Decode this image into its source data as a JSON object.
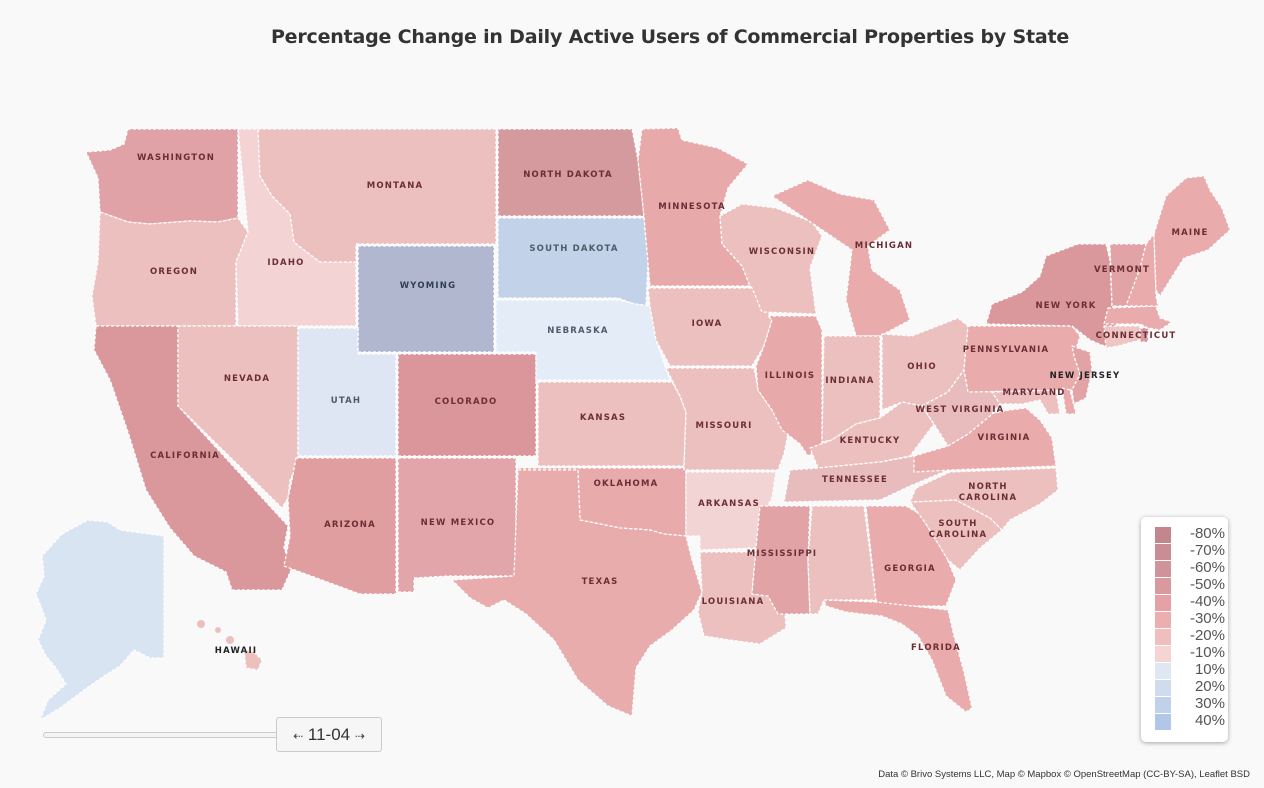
{
  "title": "Percentage Change in Daily Active Users of Commercial Properties by State",
  "legend": {
    "items": [
      {
        "label": "-80%",
        "color": "#c4868d"
      },
      {
        "label": "-70%",
        "color": "#ca8d93"
      },
      {
        "label": "-60%",
        "color": "#d0939a"
      },
      {
        "label": "-50%",
        "color": "#d9999e"
      },
      {
        "label": "-40%",
        "color": "#e5a1a3"
      },
      {
        "label": "-30%",
        "color": "#ecaeae"
      },
      {
        "label": "-20%",
        "color": "#f0bfbd"
      },
      {
        "label": "-10%",
        "color": "#f5d5d4"
      },
      {
        "label": "10%",
        "color": "#dfe7f3"
      },
      {
        "label": "20%",
        "color": "#cfdcee"
      },
      {
        "label": "30%",
        "color": "#c0d1ea"
      },
      {
        "label": "40%",
        "color": "#b2c7e7"
      }
    ]
  },
  "timeline": {
    "date": "11-04",
    "prev_arrow": "⇠",
    "next_arrow": "⇢"
  },
  "attribution": "Data © Brivo Systems LLC, Map © Mapbox © OpenStreetMap (CC-BY-SA), Leaflet BSD",
  "states": [
    {
      "name": "Washington",
      "label": "WASHINGTON",
      "color": "#e0a2a6"
    },
    {
      "name": "Oregon",
      "label": "OREGON",
      "color": "#ecc0bf"
    },
    {
      "name": "California",
      "label": "CALIFORNIA",
      "color": "#da989d"
    },
    {
      "name": "Idaho",
      "label": "IDAHO",
      "color": "#f3d3d3"
    },
    {
      "name": "Nevada",
      "label": "NEVADA",
      "color": "#ecc0bf"
    },
    {
      "name": "Montana",
      "label": "MONTANA",
      "color": "#ecc0bf"
    },
    {
      "name": "Wyoming",
      "label": "WYOMING",
      "color": "#b2b7d0"
    },
    {
      "name": "Utah",
      "label": "UTAH",
      "color": "#dfe6f3"
    },
    {
      "name": "Colorado",
      "label": "COLORADO",
      "color": "#da969b"
    },
    {
      "name": "Arizona",
      "label": "ARIZONA",
      "color": "#e09ea1"
    },
    {
      "name": "New Mexico",
      "label": "NEW MEXICO",
      "color": "#e2a6aa"
    },
    {
      "name": "North Dakota",
      "label": "NORTH DAKOTA",
      "color": "#d49a9d"
    },
    {
      "name": "South Dakota",
      "label": "SOUTH DAKOTA",
      "color": "#c2d2e8"
    },
    {
      "name": "Nebraska",
      "label": "NEBRASKA",
      "color": "#e4ecf7"
    },
    {
      "name": "Kansas",
      "label": "KANSAS",
      "color": "#ecc0bf"
    },
    {
      "name": "Oklahoma",
      "label": "OKLAHOMA",
      "color": "#e8aaab"
    },
    {
      "name": "Texas",
      "label": "TEXAS",
      "color": "#e9acad"
    },
    {
      "name": "Minnesota",
      "label": "MINNESOTA",
      "color": "#e8a9aa"
    },
    {
      "name": "Iowa",
      "label": "IOWA",
      "color": "#ecc0bf"
    },
    {
      "name": "Missouri",
      "label": "MISSOURI",
      "color": "#ecc0bf"
    },
    {
      "name": "Arkansas",
      "label": "ARKANSAS",
      "color": "#f3d4d4"
    },
    {
      "name": "Louisiana",
      "label": "LOUISIANA",
      "color": "#ecc0bf"
    },
    {
      "name": "Wisconsin",
      "label": "WISCONSIN",
      "color": "#ecc0bf"
    },
    {
      "name": "Illinois",
      "label": "ILLINOIS",
      "color": "#e8a9aa"
    },
    {
      "name": "Michigan",
      "label": "MICHIGAN",
      "color": "#e9abab"
    },
    {
      "name": "Indiana",
      "label": "INDIANA",
      "color": "#ecc0bf"
    },
    {
      "name": "Ohio",
      "label": "OHIO",
      "color": "#ecc0bf"
    },
    {
      "name": "Kentucky",
      "label": "KENTUCKY",
      "color": "#ecc0bf"
    },
    {
      "name": "Tennessee",
      "label": "TENNESSEE",
      "color": "#e8bcbd"
    },
    {
      "name": "Mississippi",
      "label": "MISSISSIPPI",
      "color": "#e2a3a6"
    },
    {
      "name": "Alabama",
      "label": "",
      "color": "#ecc0bf"
    },
    {
      "name": "Georgia",
      "label": "GEORGIA",
      "color": "#e9abab"
    },
    {
      "name": "Florida",
      "label": "FLORIDA",
      "color": "#e9abab"
    },
    {
      "name": "South Carolina",
      "label": "SOUTH CAROLINA",
      "color": "#ecc0bf"
    },
    {
      "name": "North Carolina",
      "label": "NORTH CAROLINA",
      "color": "#ecc0bf"
    },
    {
      "name": "Virginia",
      "label": "VIRGINIA",
      "color": "#e9abab"
    },
    {
      "name": "West Virginia",
      "label": "WEST VIRGINIA",
      "color": "#e8bcbd"
    },
    {
      "name": "Pennsylvania",
      "label": "PENNSYLVANIA",
      "color": "#e9abab"
    },
    {
      "name": "Maryland",
      "label": "MARYLAND",
      "color": "#ecc0bf"
    },
    {
      "name": "Delaware",
      "label": "",
      "color": "#e9abab"
    },
    {
      "name": "New Jersey",
      "label": "NEW JERSEY",
      "color": "#e2a3a6"
    },
    {
      "name": "New York",
      "label": "NEW YORK",
      "color": "#da989d"
    },
    {
      "name": "Connecticut",
      "label": "CONNECTICUT",
      "color": "#f0c6c4"
    },
    {
      "name": "Rhode Island",
      "label": "",
      "color": "#d9999e"
    },
    {
      "name": "Massachusetts",
      "label": "",
      "color": "#e9abab"
    },
    {
      "name": "Vermont",
      "label": "VERMONT",
      "color": "#e2a3a6"
    },
    {
      "name": "New Hampshire",
      "label": "",
      "color": "#e9abab"
    },
    {
      "name": "Maine",
      "label": "MAINE",
      "color": "#e9abab"
    },
    {
      "name": "Alaska",
      "label": "",
      "color": "#d8e4f2"
    },
    {
      "name": "Hawaii",
      "label": "HAWAII",
      "color": "#ecc0bf"
    }
  ]
}
